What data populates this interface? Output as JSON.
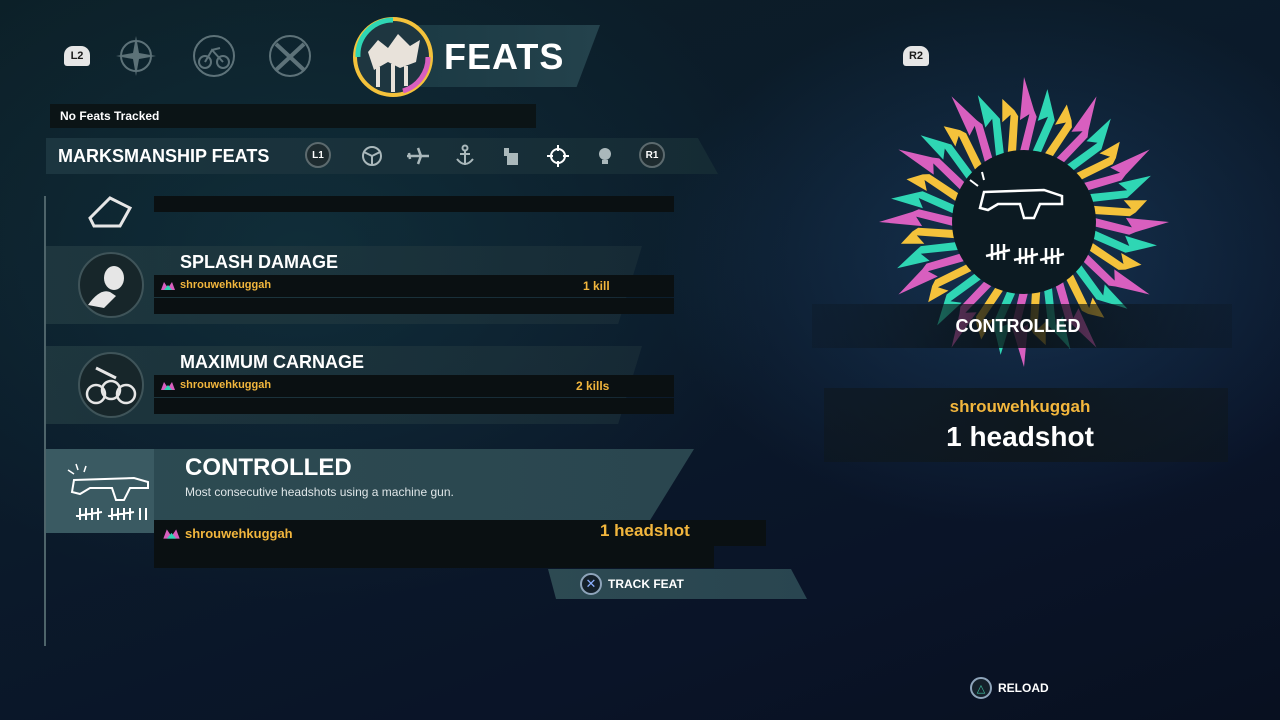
{
  "header": {
    "left_bumper": "L2",
    "right_bumper": "R2",
    "title": "FEATS",
    "tabs": [
      {
        "icon": "compass-icon"
      },
      {
        "icon": "bike-icon"
      },
      {
        "icon": "crossed-guns-icon"
      }
    ]
  },
  "tracked_status": "No Feats Tracked",
  "category": {
    "title": "MARKSMANSHIP FEATS",
    "left_button": "L1",
    "right_button": "R1",
    "icons": [
      "steering-wheel-icon",
      "plane-icon",
      "anchor-icon",
      "hand-icon",
      "crosshair-icon",
      "bulb-icon"
    ]
  },
  "feats": [
    {
      "name": "SPLASH DAMAGE",
      "player": "shrouwehkuggah",
      "score": "1 kill",
      "icon": "grenade-hand-icon"
    },
    {
      "name": "MAXIMUM CARNAGE",
      "player": "shrouwehkuggah",
      "score": "2 kills",
      "icon": "skulls-icon"
    }
  ],
  "selected": {
    "name": "CONTROLLED",
    "description": "Most consecutive headshots using a machine gun.",
    "player": "shrouwehkuggah",
    "score": "1 headshot",
    "icon": "machine-gun-icon"
  },
  "actions": {
    "track": {
      "label": "TRACK FEAT",
      "button": "✕"
    },
    "reload": {
      "label": "RELOAD",
      "button": "△"
    }
  },
  "detail": {
    "name": "CONTROLLED",
    "player": "shrouwehkuggah",
    "score": "1 headshot"
  },
  "colors": {
    "accent": "#f2b63d",
    "burst_pink": "#d85fbf",
    "burst_teal": "#2fd6b4",
    "burst_yellow": "#f4c23b"
  }
}
